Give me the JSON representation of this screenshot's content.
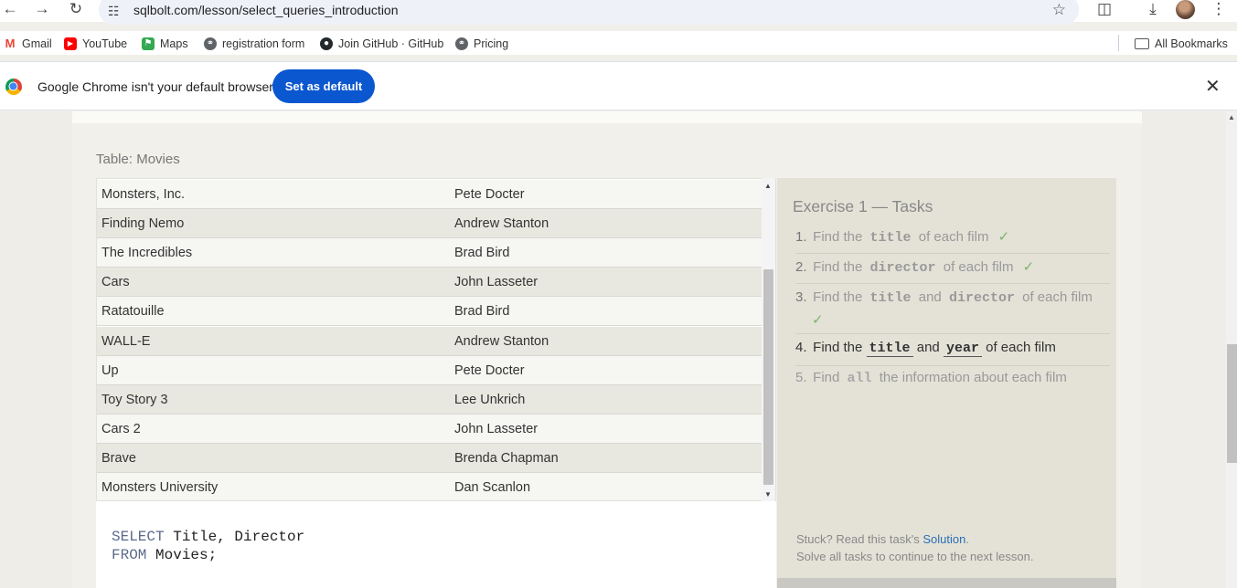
{
  "browser": {
    "url": "sqlbolt.com/lesson/select_queries_introduction",
    "bookmarks": [
      {
        "label": "Gmail",
        "icon": "gmail-icon",
        "color": "#ea4335"
      },
      {
        "label": "YouTube",
        "icon": "youtube-icon",
        "color": "#ff0000"
      },
      {
        "label": "Maps",
        "icon": "maps-icon",
        "color": "#34a853"
      },
      {
        "label": "registration form",
        "icon": "globe-icon",
        "color": "#5f6368"
      },
      {
        "label": "Join GitHub · GitHub",
        "icon": "github-icon",
        "color": "#24292e"
      },
      {
        "label": "Pricing",
        "icon": "globe-icon",
        "color": "#5f6368"
      }
    ],
    "all_bookmarks": "All Bookmarks",
    "infobar": {
      "message": "Google Chrome isn't your default browser",
      "button": "Set as default"
    }
  },
  "lesson": {
    "table_title": "Table: Movies",
    "rows": [
      {
        "title": "Monsters, Inc.",
        "director": "Pete Docter"
      },
      {
        "title": "Finding Nemo",
        "director": "Andrew Stanton"
      },
      {
        "title": "The Incredibles",
        "director": "Brad Bird"
      },
      {
        "title": "Cars",
        "director": "John Lasseter"
      },
      {
        "title": "Ratatouille",
        "director": "Brad Bird"
      },
      {
        "title": "WALL-E",
        "director": "Andrew Stanton"
      },
      {
        "title": "Up",
        "director": "Pete Docter"
      },
      {
        "title": "Toy Story 3",
        "director": "Lee Unkrich"
      },
      {
        "title": "Cars 2",
        "director": "John Lasseter"
      },
      {
        "title": "Brave",
        "director": "Brenda Chapman"
      },
      {
        "title": "Monsters University",
        "director": "Dan Scanlon"
      }
    ],
    "query": {
      "line1_kw": "SELECT",
      "line1_rest": " Title, Director",
      "line2_kw": "FROM",
      "line2_rest": " Movies;"
    }
  },
  "tasks": {
    "title": "Exercise 1 — Tasks",
    "items": [
      {
        "num": "1.",
        "pre": "Find the",
        "code1": "title",
        "mid": "",
        "code2": "",
        "post": "of each film",
        "done": true
      },
      {
        "num": "2.",
        "pre": "Find the",
        "code1": "director",
        "mid": "",
        "code2": "",
        "post": "of each film",
        "done": true
      },
      {
        "num": "3.",
        "pre": "Find the",
        "code1": "title",
        "mid": "and",
        "code2": "director",
        "post": "of each film",
        "done": true
      },
      {
        "num": "4.",
        "pre": "Find the",
        "code1": "title",
        "mid": "and",
        "code2": "year",
        "post": "of each film",
        "done": false
      },
      {
        "num": "5.",
        "pre": "Find",
        "code1": "all",
        "mid": "",
        "code2": "",
        "post": "the information about each film",
        "done": false
      }
    ],
    "check_mark": "✓",
    "stuck_prefix": "Stuck? Read this task's",
    "solution_link": "Solution",
    "stuck_suffix": ".",
    "continue_text": "Solve all tasks to continue to the next lesson."
  }
}
